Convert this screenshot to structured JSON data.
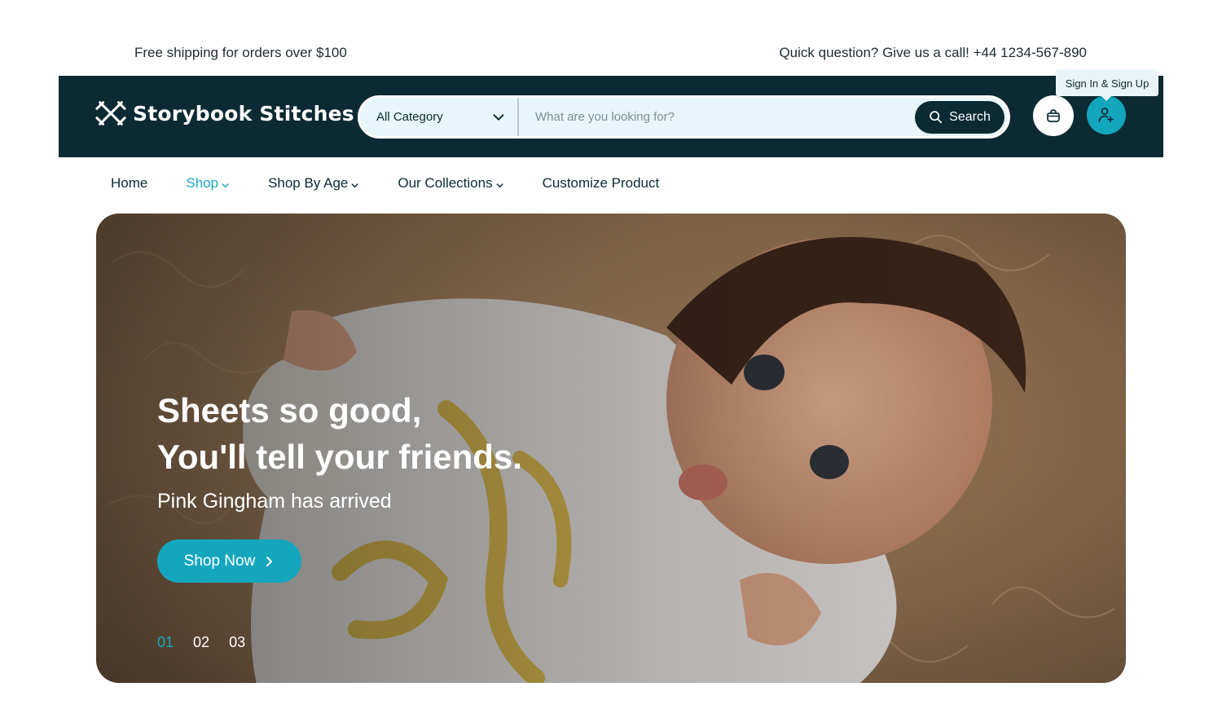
{
  "topbar": {
    "shipping_note": "Free shipping for orders over $100",
    "contact_note": "Quick question? Give us a call! +44 1234-567-890"
  },
  "header": {
    "brand": "Storybook Stitches",
    "category_label": "All Category",
    "search_placeholder": "What are you looking for?",
    "search_button": "Search",
    "account_tooltip": "Sign In & Sign Up"
  },
  "nav": {
    "items": [
      {
        "label": "Home",
        "dropdown": false
      },
      {
        "label": "Shop",
        "dropdown": true,
        "active": true
      },
      {
        "label": "Shop By Age",
        "dropdown": true
      },
      {
        "label": "Our Collections",
        "dropdown": true
      },
      {
        "label": "Customize Product",
        "dropdown": false
      }
    ]
  },
  "hero": {
    "title_line1": "Sheets so good,",
    "title_line2": "You'll tell your friends.",
    "subtitle": "Pink Gingham has arrived",
    "cta": "Shop Now",
    "slides": [
      "01",
      "02",
      "03"
    ],
    "active_slide": "01"
  },
  "colors": {
    "header_bg": "#0c2a33",
    "accent": "#14a6bd",
    "search_bg": "#e6f6fb"
  }
}
